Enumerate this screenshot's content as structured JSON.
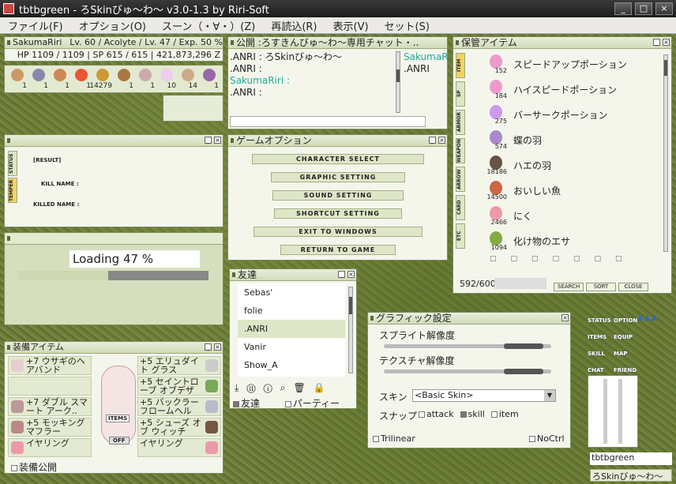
{
  "window": {
    "title": "tbtbgreen - ろSkinびゅ～わ～ v3.0-1.3 by Riri-Soft"
  },
  "menu": [
    "ファイル(F)",
    "オプション(O)",
    "スーン（・∀・）(Z)",
    "再読込(R)",
    "表示(V)",
    "セット(S)"
  ],
  "status": {
    "name": "SakumaRiri",
    "lvinfo": "Lv. 60 / Acolyte / Lv. 47 / Exp. 50 %",
    "stats": "HP 1109 / 1109 | SP 615 / 615 | 421,873,296 Z"
  },
  "hotbar": [
    "1",
    "1",
    "1",
    "1",
    "14279",
    "1",
    "1",
    "10",
    "14",
    "1"
  ],
  "chat": {
    "title": "公開 :ろすきんびゅ～わ～専用チャット・..",
    "lines": [
      ".ANRI : ろSkinびゅ～わ～",
      ".ANRI :",
      "SakumaRiri :",
      ".ANRI :"
    ],
    "members": [
      "SakumaRir",
      ".ANRI"
    ]
  },
  "status_win": {
    "tabs": [
      "STATUS",
      "TEMPER"
    ],
    "result": "[RESULT]",
    "kill": "KILL NAME :",
    "killed": "KILLED NAME :"
  },
  "loading": {
    "text": "Loading 47 %",
    "progress": 0.47
  },
  "game_opt": {
    "title": "ゲームオプション",
    "buttons": [
      "CHARACTER SELECT",
      "GRAPHIC SETTING",
      "SOUND SETTING",
      "SHORTCUT SETTING",
      "EXIT TO WINDOWS",
      "RETURN TO GAME"
    ]
  },
  "storage": {
    "title": "保管アイテム",
    "tabs": [
      "ITEM",
      "SP",
      "ARMOR",
      "WEAPON",
      "ARROW",
      "CARD",
      "ETC"
    ],
    "items": [
      {
        "count": "152",
        "name": "スピードアップポーション"
      },
      {
        "count": "184",
        "name": "ハイスピードポーション"
      },
      {
        "count": "275",
        "name": "バーサークポーション"
      },
      {
        "count": "574",
        "name": "蝶の羽"
      },
      {
        "count": "18186",
        "name": "ハエの羽"
      },
      {
        "count": "14500",
        "name": "おいしい魚"
      },
      {
        "count": "2466",
        "name": "にく"
      },
      {
        "count": "1094",
        "name": "化け物のエサ"
      }
    ],
    "capacity": "592/600",
    "buttons": [
      "SEARCH",
      "SORT",
      "CLOSE"
    ]
  },
  "friends": {
    "title": "友達",
    "list": [
      "Sebas'",
      "folie",
      ".ANRI",
      "Vanir",
      "Show_A"
    ],
    "tab1": "友達",
    "tab2": "パーティー"
  },
  "gfx": {
    "title": "グラフィック設定",
    "sprite": "スプライト解像度",
    "texture": "テクスチャ解像度",
    "skin_label": "スキン",
    "skin_value": "<Basic Skin>",
    "snap_label": "スナップ",
    "snap": [
      "attack",
      "skill",
      "item"
    ],
    "trilinear": "Trilinear",
    "noctrl": "NoCtrl"
  },
  "equip": {
    "title": "装備アイテム",
    "left": [
      "+7 ウサギのヘアバンド",
      "",
      "+7 ダブル スマート アーク..",
      "+5 モッキング マフラー",
      "イヤリング"
    ],
    "right": [
      "+5 エリュダイト グラス",
      "+5 セイントローブ オブデザー",
      "+5 バックラー フロームヘル",
      "+5 シューズ オブ ウィッチ",
      "イヤリング"
    ],
    "items_label": "ITEMS",
    "off_label": "OFF",
    "public": "装備公開"
  },
  "shortcuts": {
    "buttons": [
      "STATUS",
      "OPTION",
      "ITEMS",
      "EQUIP",
      "SKILL",
      "MAP",
      "CHAT",
      "FRIEND"
    ]
  },
  "mini": {
    "name": "tbtbgreen",
    "skin": "ろSkinびゅ～わ～"
  }
}
